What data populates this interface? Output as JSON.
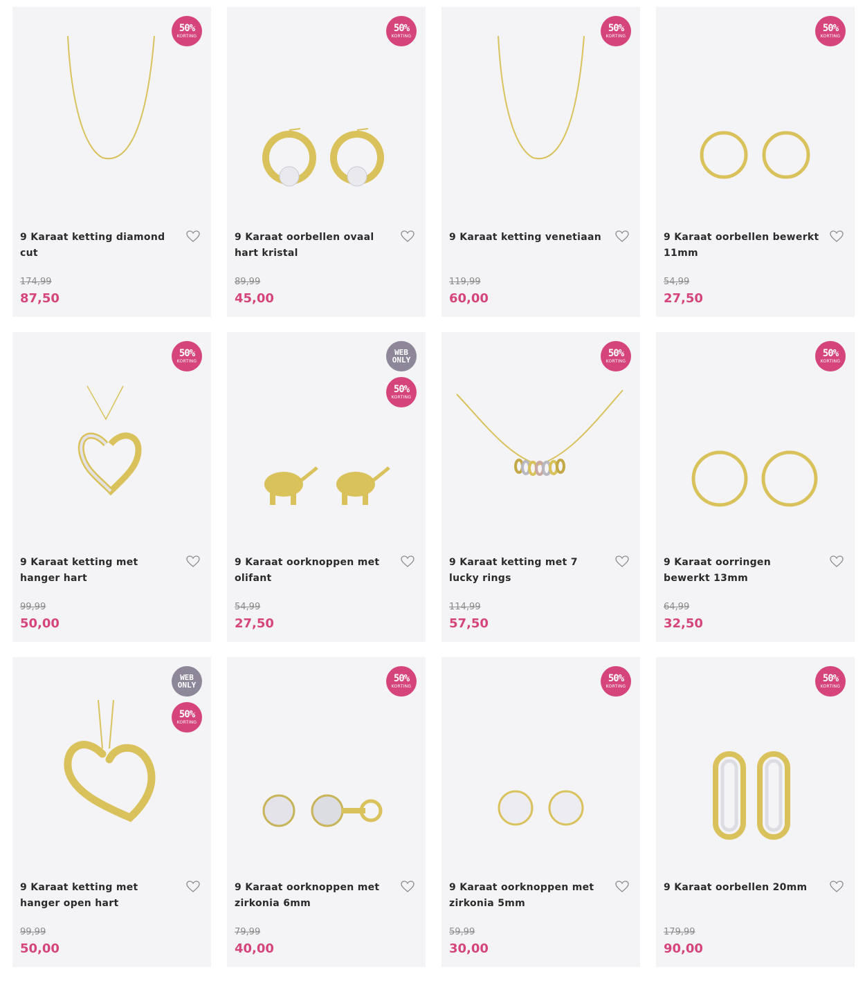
{
  "colors": {
    "sale": "#d5457b",
    "web_only": "#8d8799",
    "card_bg": "#f4f4f7",
    "gold": "#d9c25c"
  },
  "products": [
    {
      "title": "9 Karaat ketting diamond cut",
      "old_price": "174,99",
      "price": "87,50",
      "badge_sale": "50%",
      "badge_sale_sub": "KORTING",
      "image": "chain-necklace"
    },
    {
      "title": "9 Karaat oorbellen ovaal hart kristal",
      "old_price": "89,99",
      "price": "45,00",
      "badge_sale": "50%",
      "badge_sale_sub": "KORTING",
      "image": "hoop-heart-crystal-earrings"
    },
    {
      "title": "9 Karaat ketting venetiaan",
      "old_price": "119,99",
      "price": "60,00",
      "badge_sale": "50%",
      "badge_sale_sub": "KORTING",
      "image": "chain-necklace"
    },
    {
      "title": "9 Karaat oorbellen bewerkt 11mm",
      "old_price": "54,99",
      "price": "27,50",
      "badge_sale": "50%",
      "badge_sale_sub": "KORTING",
      "image": "small-hoop-earrings"
    },
    {
      "title": "9 Karaat ketting met hanger hart",
      "old_price": "99,99",
      "price": "50,00",
      "badge_sale": "50%",
      "badge_sale_sub": "KORTING",
      "image": "heart-pendant-necklace"
    },
    {
      "title": "9 Karaat oorknoppen met olifant",
      "old_price": "54,99",
      "price": "27,50",
      "badge_web_1": "WEB",
      "badge_web_2": "ONLY",
      "badge_sale": "50%",
      "badge_sale_sub": "KORTING",
      "image": "elephant-stud-earrings"
    },
    {
      "title": "9 Karaat ketting met 7 lucky rings",
      "old_price": "114,99",
      "price": "57,50",
      "badge_sale": "50%",
      "badge_sale_sub": "KORTING",
      "image": "lucky-rings-necklace"
    },
    {
      "title": "9 Karaat oorringen bewerkt 13mm",
      "old_price": "64,99",
      "price": "32,50",
      "badge_sale": "50%",
      "badge_sale_sub": "KORTING",
      "image": "large-hoop-earrings"
    },
    {
      "title": "9 Karaat ketting met hanger open hart",
      "old_price": "99,99",
      "price": "50,00",
      "badge_web_1": "WEB",
      "badge_web_2": "ONLY",
      "badge_sale": "50%",
      "badge_sale_sub": "KORTING",
      "image": "open-heart-pendant"
    },
    {
      "title": "9 Karaat oorknoppen met zirkonia 6mm",
      "old_price": "79,99",
      "price": "40,00",
      "badge_sale": "50%",
      "badge_sale_sub": "KORTING",
      "image": "zirconia-studs-6mm"
    },
    {
      "title": "9 Karaat oorknoppen met zirkonia 5mm",
      "old_price": "59,99",
      "price": "30,00",
      "badge_sale": "50%",
      "badge_sale_sub": "KORTING",
      "image": "zirconia-studs-5mm"
    },
    {
      "title": "9 Karaat oorbellen 20mm",
      "old_price": "179,99",
      "price": "90,00",
      "badge_sale": "50%",
      "badge_sale_sub": "KORTING",
      "image": "glitter-hoop-earrings"
    }
  ]
}
